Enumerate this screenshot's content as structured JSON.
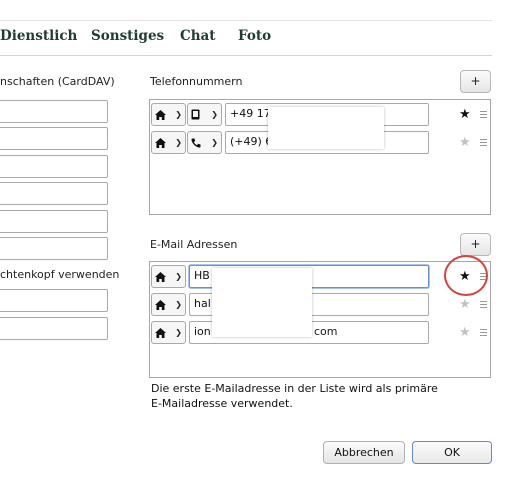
{
  "tabs": [
    {
      "label": "Dienstlich"
    },
    {
      "label": "Sonstiges"
    },
    {
      "label": "Chat"
    },
    {
      "label": "Foto"
    }
  ],
  "left": {
    "section_label": "nschaften (CardDAV)",
    "header_label": "chtenkopf verwenden",
    "fields_top_count": 7,
    "fields_bottom_count": 2
  },
  "phone": {
    "section_label": "Telefonnummern",
    "add_label": "+",
    "rows": [
      {
        "type_icon": "home-icon",
        "kind_icon": "mobile-phone-icon",
        "value": "+49 17",
        "primary": true
      },
      {
        "type_icon": "home-icon",
        "kind_icon": "telephone-icon",
        "value": "(+49) 6",
        "primary": false
      }
    ]
  },
  "email": {
    "section_label": "E-Mail Adressen",
    "add_label": "+",
    "rows": [
      {
        "type_icon": "home-icon",
        "value": "HB",
        "primary": true
      },
      {
        "type_icon": "home-icon",
        "value": "hal",
        "primary": false
      },
      {
        "type_icon": "home-icon",
        "value": "ion",
        "suffix": "com",
        "primary": false
      }
    ],
    "hint": "Die erste E-Mailadresse in der Liste wird als primäre E-Mailadresse verwendet."
  },
  "footer": {
    "cancel_label": "Abbrechen",
    "ok_label": "OK"
  },
  "colors": {
    "tab_text": "#1f3b34",
    "annotation_circle": "#d8413a",
    "focus_border": "#6a8fd6"
  }
}
